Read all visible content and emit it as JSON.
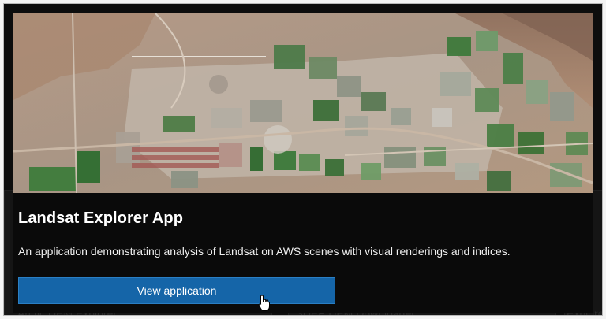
{
  "background_cards": [
    {
      "label": "Arctic DEM Explorer"
    },
    {
      "label": "3DEP DEM Downloader"
    },
    {
      "label": "Explorer"
    }
  ],
  "card": {
    "image_alt_icon": "satellite-farmland-thumbnail",
    "title": "Landsat Explorer App",
    "description": "An application demonstrating analysis of Landsat on AWS scenes with visual renderings and indices.",
    "button_label": "View application"
  },
  "colors": {
    "button": "#1565a8",
    "card_background": "#0a0a0a",
    "title": "#ffffff"
  },
  "cursor_icon": "hand-pointer-icon"
}
